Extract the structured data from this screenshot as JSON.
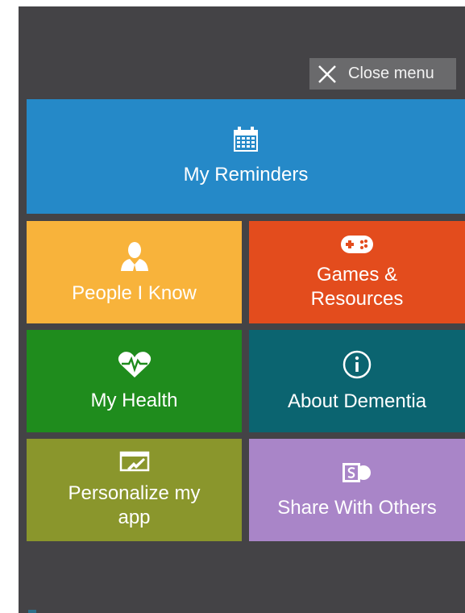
{
  "header": {
    "close_label": "Close menu"
  },
  "tiles": [
    {
      "label": "My Reminders",
      "icon": "calendar-icon",
      "color": "#2589c8"
    },
    {
      "label": "People I Know",
      "icon": "person-icon",
      "color": "#f8b33b"
    },
    {
      "label": "Games & Resources",
      "label_line1": "Games &",
      "label_line2": "Resources",
      "icon": "gamepad-icon",
      "color": "#e34c1d"
    },
    {
      "label": "My Health",
      "icon": "heartbeat-icon",
      "color": "#1f8c1d"
    },
    {
      "label": "About Dementia",
      "icon": "info-icon",
      "color": "#0b6470"
    },
    {
      "label": "Personalize my app",
      "label_line1": "Personalize my",
      "label_line2": "app",
      "icon": "personalize-icon",
      "color": "#8a962c"
    },
    {
      "label": "Share With Others",
      "icon": "sharepoint-icon",
      "color": "#a985c8"
    }
  ]
}
